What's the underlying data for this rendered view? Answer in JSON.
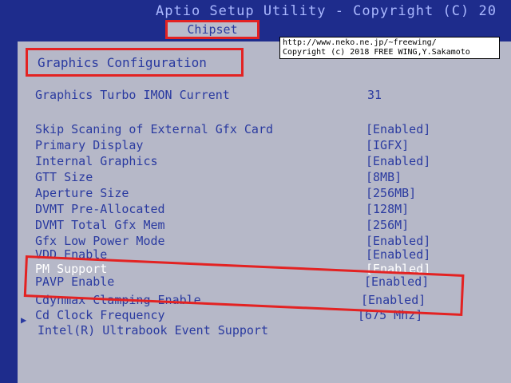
{
  "header": {
    "title": "Aptio Setup Utility - Copyright (C) 20",
    "active_tab": "Chipset"
  },
  "watermark": {
    "line1": "http://www.neko.ne.jp/~freewing/",
    "line2": "Copyright (c) 2018 FREE WING,Y.Sakamoto"
  },
  "section": {
    "title": "Graphics Configuration"
  },
  "items": [
    {
      "label": "Graphics Turbo IMON Current",
      "value": "31"
    },
    {
      "label": "Skip Scaning of External Gfx Card",
      "value": "[Enabled]"
    },
    {
      "label": "Primary Display",
      "value": "[IGFX]"
    },
    {
      "label": "Internal Graphics",
      "value": "[Enabled]"
    },
    {
      "label": "GTT Size",
      "value": "[8MB]"
    },
    {
      "label": "Aperture Size",
      "value": "[256MB]"
    },
    {
      "label": "DVMT Pre-Allocated",
      "value": "[128M]"
    },
    {
      "label": "DVMT Total Gfx Mem",
      "value": "[256M]"
    },
    {
      "label": "Gfx Low Power Mode",
      "value": "[Enabled]"
    },
    {
      "label": "VDD Enable",
      "value": "[Enabled]"
    },
    {
      "label": "PM Support",
      "value": "[Enabled]"
    },
    {
      "label": "PAVP Enable",
      "value": "[Enabled]"
    },
    {
      "label": "Cdynmax Clamping Enable",
      "value": "[Enabled]"
    },
    {
      "label": "Cd Clock Frequency",
      "value": "[675 Mhz]"
    },
    {
      "label": "Intel(R) Ultrabook Event Support",
      "value": ""
    }
  ]
}
